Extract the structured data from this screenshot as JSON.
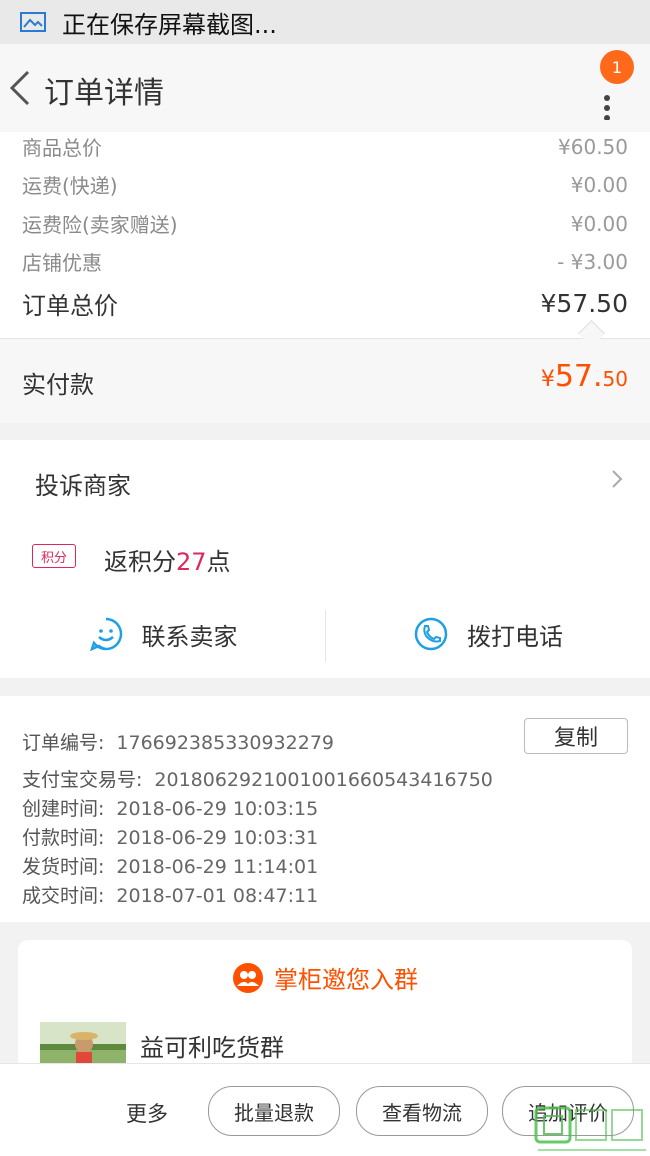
{
  "status_bar": {
    "text": "正在保存屏幕截图..."
  },
  "header": {
    "title": "订单详情",
    "badge_count": "1"
  },
  "price": {
    "rows": [
      {
        "label": "商品总价",
        "value": "¥60.50"
      },
      {
        "label": "运费(快递)",
        "value": "¥0.00"
      },
      {
        "label": "运费险(卖家赠送)",
        "value": "¥0.00"
      },
      {
        "label": "店铺优惠",
        "value": "- ¥3.00"
      }
    ],
    "total_label": "订单总价",
    "total_value": "¥57.50",
    "paid_label": "实付款",
    "paid_currency": "¥",
    "paid_int": "57.",
    "paid_dec": "50"
  },
  "complaint": {
    "label": "投诉商家"
  },
  "points": {
    "tag": "积分",
    "prefix": "返积分",
    "count": "27",
    "suffix": "点"
  },
  "contact": {
    "seller_label": "联系卖家",
    "call_label": "拨打电话"
  },
  "order_info": {
    "copy_label": "复制",
    "rows": [
      {
        "label": "订单编号:",
        "value": "176692385330932279"
      },
      {
        "label": "支付宝交易号:",
        "value": "2018062921001001660543416750"
      },
      {
        "label": "创建时间:",
        "value": "2018-06-29 10:03:15"
      },
      {
        "label": "付款时间:",
        "value": "2018-06-29 10:03:31"
      },
      {
        "label": "发货时间:",
        "value": "2018-06-29 11:14:01"
      },
      {
        "label": "成交时间:",
        "value": "2018-07-01 08:47:11"
      }
    ]
  },
  "group": {
    "title": "掌柜邀您入群",
    "name": "益可利吃货群"
  },
  "bottom": {
    "more": "更多",
    "refund": "批量退款",
    "logistics": "查看物流",
    "review": "追加评价"
  },
  "colors": {
    "accent": "#ff5000",
    "points": "#e0275a",
    "link_blue": "#1e9fe6"
  }
}
